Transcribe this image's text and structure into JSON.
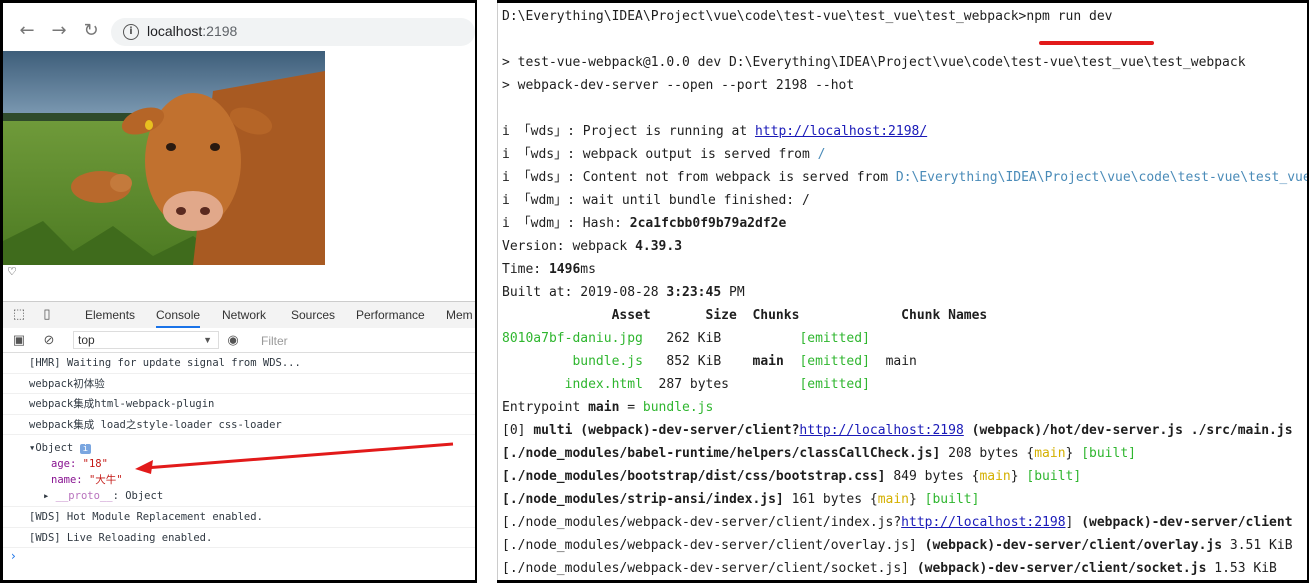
{
  "browser": {
    "url_host": "localhost",
    "url_port": ":2198"
  },
  "devtools": {
    "tabs": [
      "Elements",
      "Console",
      "Network",
      "Sources",
      "Performance",
      "Mem"
    ],
    "context": "top",
    "filter_placeholder": "Filter",
    "console": {
      "lines": [
        "[HMR] Waiting for update signal from WDS...",
        "webpack初体验",
        "webpack集成html-webpack-plugin",
        "webpack集成 load之style-loader css-loader"
      ],
      "object": {
        "label": "Object",
        "age_key": "age:",
        "age_val": "\"18\"",
        "name_key": "name:",
        "name_val": "\"大牛\"",
        "proto_key": "__proto__",
        "proto_val": ": Object"
      },
      "after": [
        "[WDS] Hot Module Replacement enabled.",
        "[WDS] Live Reloading enabled."
      ]
    }
  },
  "terminal": {
    "prompt": "D:\\Everything\\IDEA\\Project\\vue\\code\\test-vue\\test_vue\\test_webpack>",
    "command": "npm run dev",
    "l2": "> test-vue-webpack@1.0.0 dev D:\\Everything\\IDEA\\Project\\vue\\code\\test-vue\\test_vue\\test_webpack",
    "l3": "> webpack-dev-server --open --port 2198 --hot",
    "wds_prefix": "i 「wds」: ",
    "wdm_prefix": "i 「wdm」: ",
    "l4_text": "Project is running at ",
    "l4_link": "http://localhost:2198/",
    "l5_text": "webpack output is served from ",
    "l5_path": "/",
    "l6_text": "Content not from webpack is served from ",
    "l6_path": "D:\\Everything\\IDEA\\Project\\vue\\code\\test-vue\\test_vue",
    "l7_text": "wait until bundle finished: /",
    "l8_text": "Hash: ",
    "l8_hash": "2ca1fcbb0f9b79a2df2e",
    "version_label": "Version: webpack ",
    "version": "4.39.3",
    "time_label": "Time: ",
    "time": "1496",
    "time_unit": "ms",
    "built_label": "Built at: 2019-08-28 ",
    "built_time": "3:23:45",
    "built_pm": " PM",
    "table_header": "              Asset       Size  Chunks             Chunk Names",
    "assets": [
      {
        "name": "8010a7bf-daniu.jpg",
        "pad": "",
        "size": "   262 KiB",
        "chunk": "",
        "status": "[emitted]",
        "cname": ""
      },
      {
        "name": "bundle.js",
        "pad": "         ",
        "size": "   852 KiB",
        "chunk": "main",
        "status": "[emitted]",
        "cname": "main"
      },
      {
        "name": "index.html",
        "pad": "        ",
        "size": "  287 bytes",
        "chunk": "",
        "status": "[emitted]",
        "cname": ""
      }
    ],
    "entry_label": "Entrypoint ",
    "entry_main": "main",
    "entry_eq": " = ",
    "entry_file": "bundle.js",
    "mod0_a": "[0] ",
    "mod0_b": "multi (webpack)-dev-server/client?",
    "mod0_link": "http://localhost:2198",
    "mod0_c": " (webpack)/hot/dev-server.js ./src/main.js",
    "mod1_a": "[./node_modules/babel-runtime/helpers/classCallCheck.js]",
    "mod1_b": " 208 bytes {",
    "mod1_c": "main",
    "mod1_d": "} ",
    "built": "[built]",
    "mod2_a": "[./node_modules/bootstrap/dist/css/bootstrap.css]",
    "mod2_b": " 849 bytes {",
    "mod3_a": "[./node_modules/strip-ansi/index.js]",
    "mod3_b": " 161 bytes {",
    "mod4_a": "[./node_modules/webpack-dev-server/client/index.js?",
    "mod4_link": "http://localhost:2198",
    "mod4_b": "]",
    "mod4_c": " (webpack)-dev-server/client",
    "mod5_a": "[./node_modules/webpack-dev-server/client/overlay.js]",
    "mod5_b": " (webpack)-dev-server/client/overlay.js",
    "mod5_c": " 3.51 KiB",
    "mod6_a": "[./node_modules/webpack-dev-server/client/socket.js]",
    "mod6_b": " (webpack)-dev-server/client/socket.js",
    "mod6_c": " 1.53 KiB"
  },
  "colors": {
    "accent": "#1a73e8",
    "annotation": "#e21a1a",
    "emitted": "#2fb62f"
  }
}
